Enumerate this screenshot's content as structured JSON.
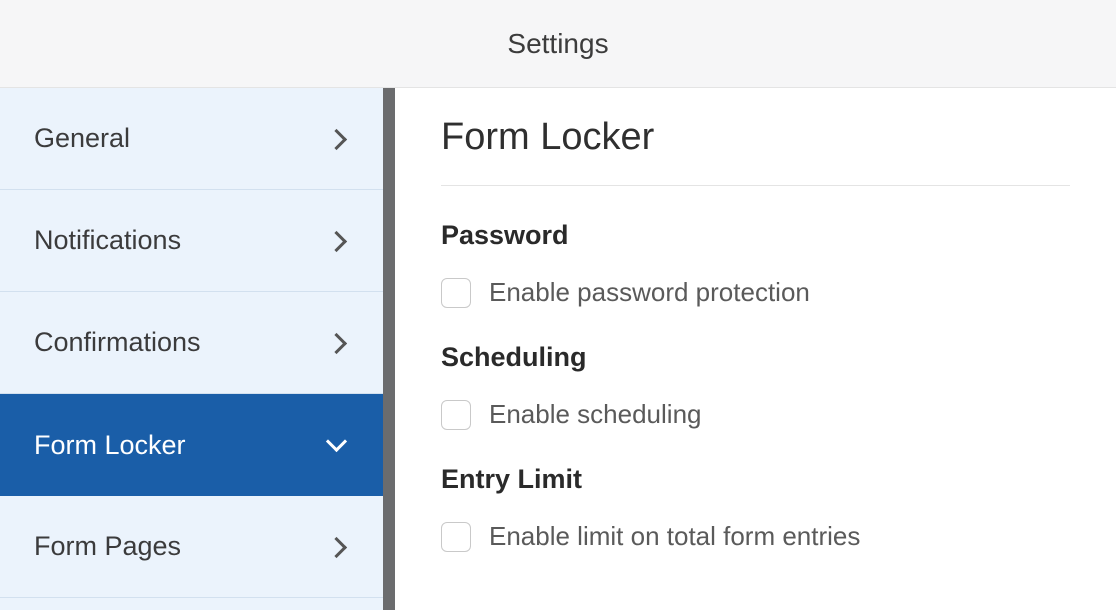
{
  "header": {
    "title": "Settings"
  },
  "sidebar": {
    "items": [
      {
        "label": "General"
      },
      {
        "label": "Notifications"
      },
      {
        "label": "Confirmations"
      },
      {
        "label": "Form Locker"
      },
      {
        "label": "Form Pages"
      }
    ]
  },
  "main": {
    "title": "Form Locker",
    "sections": {
      "password": {
        "heading": "Password",
        "checkbox_label": "Enable password protection"
      },
      "scheduling": {
        "heading": "Scheduling",
        "checkbox_label": "Enable scheduling"
      },
      "entryLimit": {
        "heading": "Entry Limit",
        "checkbox_label": "Enable limit on total form entries"
      }
    }
  }
}
